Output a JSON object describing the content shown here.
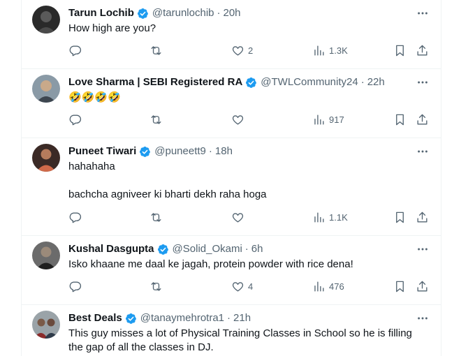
{
  "brand_color": "#1d9bf0",
  "muted_color": "#536471",
  "tweets": [
    {
      "name": "Tarun Lochib",
      "handle": "@tarunlochib",
      "separator": "·",
      "time": "20h",
      "text": [
        "How high are you?"
      ],
      "replies": "",
      "retweets": "",
      "likes": "2",
      "views": "1.3K"
    },
    {
      "name": "Love Sharma | SEBI Registered RA",
      "handle": "@TWLCommunity24",
      "separator": "·",
      "time": "22h",
      "text": [
        "🤣🤣🤣🤣"
      ],
      "replies": "",
      "retweets": "",
      "likes": "",
      "views": "917"
    },
    {
      "name": "Puneet Tiwari",
      "handle": "@puneett9",
      "separator": "·",
      "time": "18h",
      "text": [
        "hahahaha",
        "bachcha agniveer ki bharti dekh raha hoga"
      ],
      "replies": "",
      "retweets": "",
      "likes": "",
      "views": "1.1K"
    },
    {
      "name": "Kushal Dasgupta",
      "handle": "@Solid_Okami",
      "separator": "·",
      "time": "6h",
      "text": [
        "Isko khaane me daal ke jagah, protein powder with rice dena!"
      ],
      "replies": "",
      "retweets": "",
      "likes": "4",
      "views": "476"
    },
    {
      "name": "Best Deals",
      "handle": "@tanaymehrotra1",
      "separator": "·",
      "time": "21h",
      "text": [
        "This guy misses a lot of Physical Training Classes in School so he is filling the gap of all the classes in DJ."
      ],
      "replies": "",
      "retweets": "",
      "likes": "",
      "views": ""
    }
  ]
}
